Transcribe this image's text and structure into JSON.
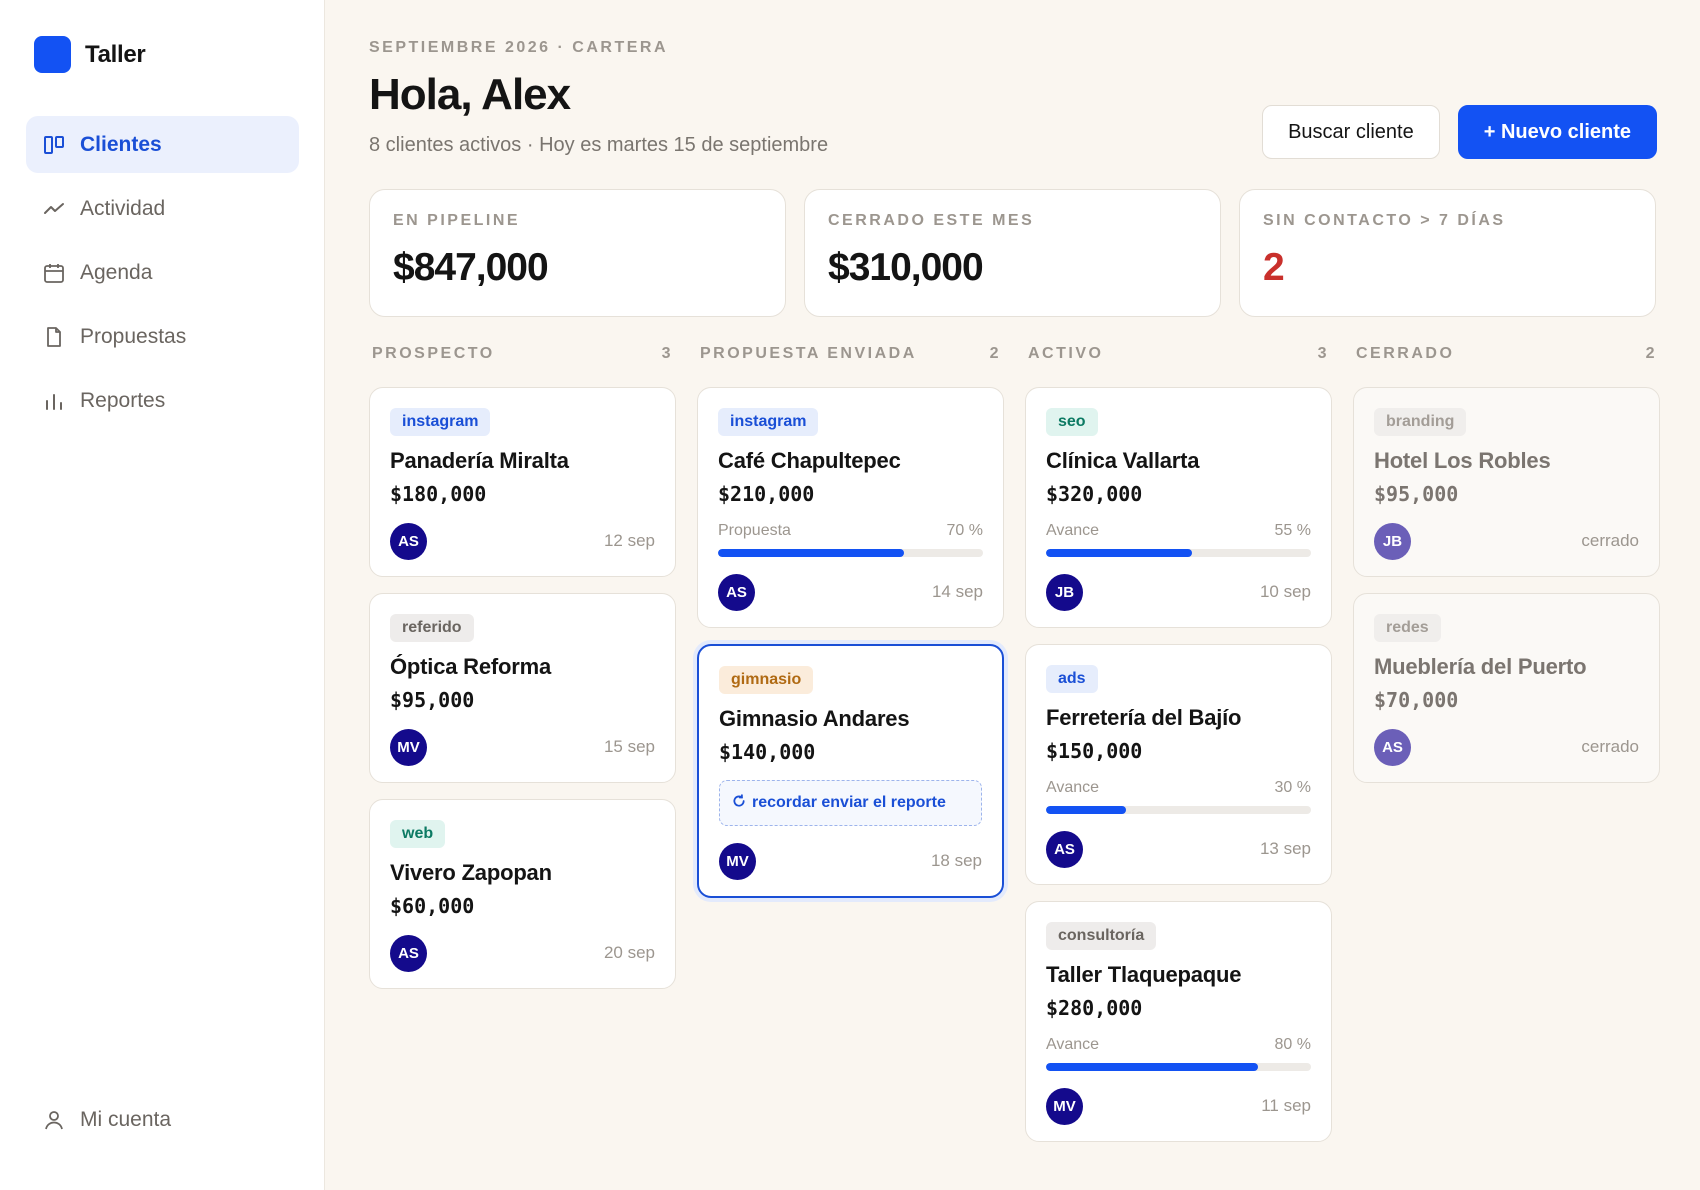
{
  "app": {
    "name": "Taller",
    "brand_color": "#1352f3"
  },
  "sidebar": {
    "items": [
      {
        "label": "Clientes",
        "icon": "kanban-icon",
        "active": true
      },
      {
        "label": "Actividad",
        "icon": "trend-icon",
        "active": false
      },
      {
        "label": "Agenda",
        "icon": "calendar-icon",
        "active": false
      },
      {
        "label": "Propuestas",
        "icon": "document-icon",
        "active": false
      },
      {
        "label": "Reportes",
        "icon": "bar-chart-icon",
        "active": false
      }
    ],
    "account": {
      "label": "Mi cuenta",
      "icon": "user-icon"
    }
  },
  "header": {
    "eyebrow": "SEPTIEMBRE 2026 · CARTERA",
    "greeting": "Hola, Alex",
    "subtitle": "8 clientes activos · Hoy es martes 15 de septiembre",
    "search_label": "Buscar cliente",
    "new_label": "+ Nuevo cliente"
  },
  "stats": [
    {
      "label": "EN PIPELINE",
      "value": "$847,000"
    },
    {
      "label": "CERRADO ESTE MES",
      "value": "$310,000"
    },
    {
      "label": "SIN CONTACTO > 7 DÍAS",
      "value": "2",
      "alert_color": "#c9302c"
    }
  ],
  "columns": [
    {
      "title": "PROSPECTO",
      "count": "3",
      "cards": [
        {
          "tag": "instagram",
          "name": "Panadería Miralta",
          "amount": "$180,000",
          "owner": "AS",
          "date": "12 sep"
        },
        {
          "tag": "referido",
          "name": "Óptica Reforma",
          "amount": "$95,000",
          "owner": "MV",
          "date": "15 sep"
        },
        {
          "tag": "web",
          "name": "Vivero Zapopan",
          "amount": "$60,000",
          "owner": "AS",
          "date": "20 sep"
        }
      ]
    },
    {
      "title": "PROPUESTA ENVIADA",
      "count": "2",
      "cards": [
        {
          "tag": "instagram",
          "name": "Café Chapultepec",
          "amount": "$210,000",
          "progress_label": "Propuesta",
          "progress_text": "70 %",
          "progress": 0.7,
          "owner": "AS",
          "date": "14 sep"
        },
        {
          "tag": "gimnasio",
          "name": "Gimnasio Andares",
          "amount": "$140,000",
          "note": "recordar enviar el reporte",
          "owner": "MV",
          "date": "18 sep",
          "selected": true
        }
      ]
    },
    {
      "title": "ACTIVO",
      "count": "3",
      "cards": [
        {
          "tag": "seo",
          "name": "Clínica Vallarta",
          "amount": "$320,000",
          "progress_label": "Avance",
          "progress_text": "55 %",
          "progress": 0.55,
          "owner": "JB",
          "date": "10 sep"
        },
        {
          "tag": "ads",
          "name": "Ferretería del Bajío",
          "amount": "$150,000",
          "progress_label": "Avance",
          "progress_text": "30 %",
          "progress": 0.3,
          "owner": "AS",
          "date": "13 sep"
        },
        {
          "tag": "consultoría",
          "name": "Taller Tlaquepaque",
          "amount": "$280,000",
          "progress_label": "Avance",
          "progress_text": "80 %",
          "progress": 0.8,
          "owner": "MV",
          "date": "11 sep"
        }
      ]
    },
    {
      "title": "CERRADO",
      "count": "2",
      "cards": [
        {
          "tag": "branding",
          "name": "Hotel Los Robles",
          "amount": "$95,000",
          "owner": "JB",
          "date": "cerrado",
          "closed": true
        },
        {
          "tag": "redes",
          "name": "Mueblería del Puerto",
          "amount": "$70,000",
          "owner": "AS",
          "date": "cerrado",
          "closed": true
        }
      ]
    }
  ]
}
